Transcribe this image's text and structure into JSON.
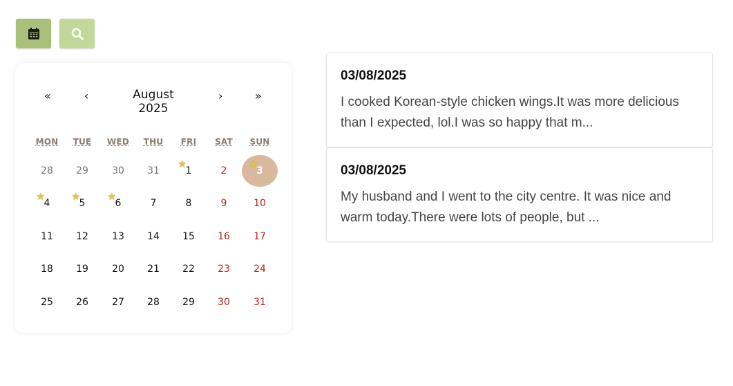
{
  "toolbar": {
    "calendar_icon": "calendar-icon",
    "search_icon": "search-icon",
    "calendar_color": "#a9c07a",
    "search_color": "#c1d89a"
  },
  "calendar": {
    "month_label": "August 2025",
    "nav": {
      "first": "«",
      "prev": "‹",
      "next": "›",
      "last": "»"
    },
    "weekdays": [
      "MON",
      "TUE",
      "WED",
      "THU",
      "FRI",
      "SAT",
      "SUN"
    ],
    "weeks": [
      [
        "28",
        "29",
        "30",
        "31",
        "1",
        "2",
        "3"
      ],
      [
        "4",
        "5",
        "6",
        "7",
        "8",
        "9",
        "10"
      ],
      [
        "11",
        "12",
        "13",
        "14",
        "15",
        "16",
        "17"
      ],
      [
        "18",
        "19",
        "20",
        "21",
        "22",
        "23",
        "24"
      ],
      [
        "25",
        "26",
        "27",
        "28",
        "29",
        "30",
        "31"
      ]
    ],
    "selected_day": "3",
    "starred_days": [
      "1",
      "3",
      "4",
      "5",
      "6"
    ]
  },
  "entries": [
    {
      "date": "03/08/2025",
      "text": "I cooked Korean-style chicken wings.It was more delicious than I expected, lol.I was so happy that m..."
    },
    {
      "date": "03/08/2025",
      "text": "My husband and I went to the city centre. It was nice and warm today.There were lots of people, but ..."
    }
  ]
}
